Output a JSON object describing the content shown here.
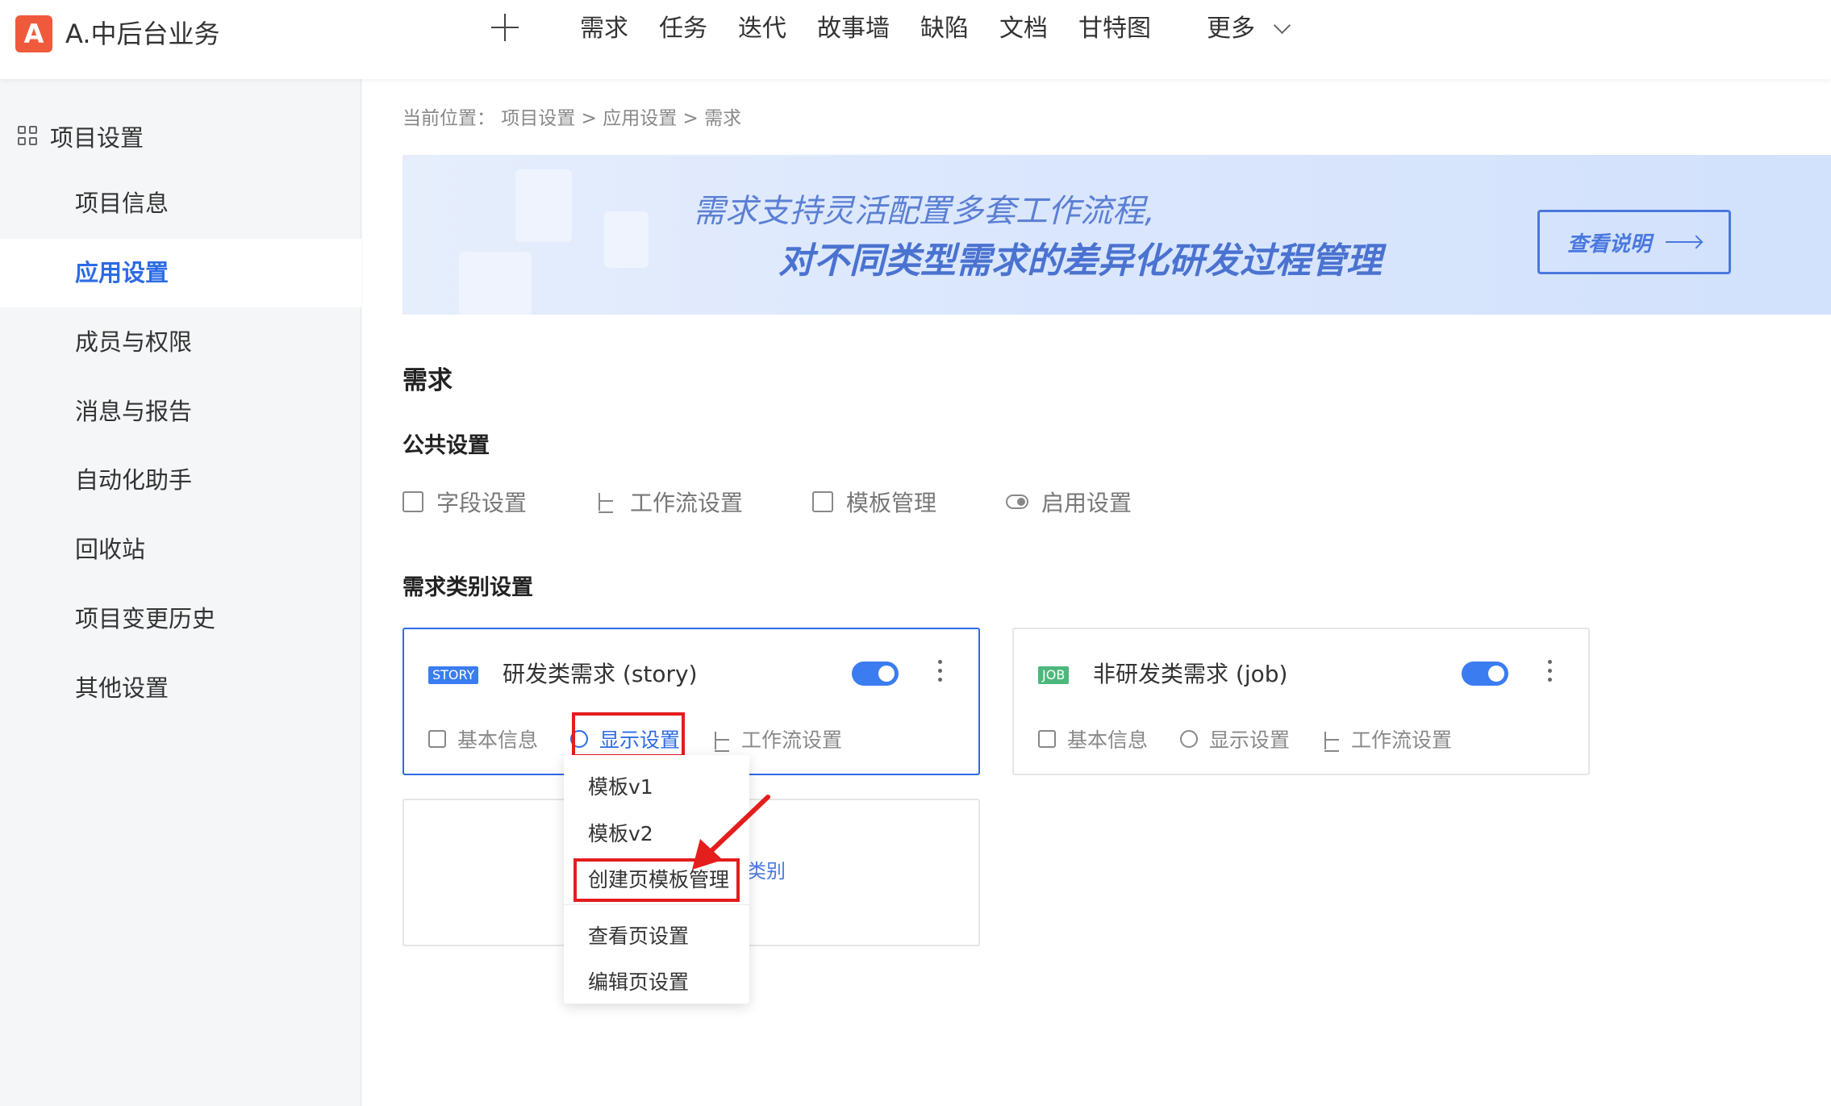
{
  "topbar": {
    "logo_letter": "A",
    "project_name": "A.中后台业务",
    "nav": [
      "需求",
      "任务",
      "迭代",
      "故事墙",
      "缺陷",
      "文档",
      "甘特图"
    ],
    "more_label": "更多"
  },
  "sidebar": {
    "heading": "项目设置",
    "items": [
      "项目信息",
      "应用设置",
      "成员与权限",
      "消息与报告",
      "自动化助手",
      "回收站",
      "项目变更历史",
      "其他设置"
    ],
    "active_index": 1
  },
  "main": {
    "breadcrumb": "当前位置： 项目设置 > 应用设置 > 需求",
    "banner": {
      "line1": "需求支持灵活配置多套工作流程,",
      "line2": "对不同类型需求的差异化研发过程管理",
      "button": "查看说明"
    },
    "section_title": "需求",
    "public_title": "公共设置",
    "public_items": [
      "字段设置",
      "工作流设置",
      "模板管理",
      "启用设置"
    ],
    "category_title": "需求类别设置",
    "cards": [
      {
        "tag": "STORY",
        "tag_color": "#3b7cf0",
        "title": "研发类需求 (story)",
        "enabled": true,
        "links": [
          "基本信息",
          "显示设置",
          "工作流设置"
        ]
      },
      {
        "tag": "JOB",
        "tag_color": "#4cb87c",
        "title": "非研发类需求 (job)",
        "enabled": true,
        "links": [
          "基本信息",
          "显示设置",
          "工作流设置"
        ]
      }
    ],
    "add_card_text": "类别",
    "dropdown": [
      "模板v1",
      "模板v2",
      "创建页模板管理",
      "查看页设置",
      "编辑页设置"
    ]
  },
  "colors": {
    "accent": "#2d6be4",
    "highlight": "#e41d1d"
  }
}
